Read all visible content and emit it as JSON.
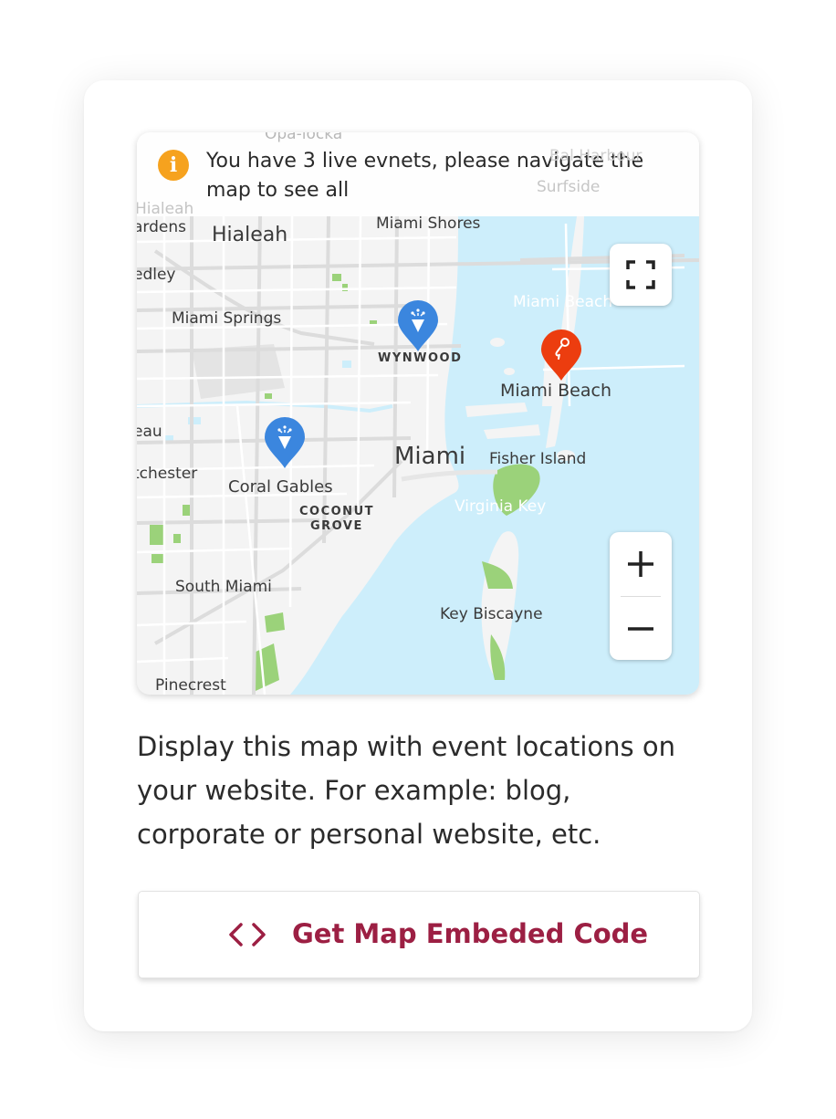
{
  "notice": {
    "icon": "info-icon",
    "icon_glyph": "i",
    "message": "You have 3 live evnets, please navigate the map to see all"
  },
  "map": {
    "labels": [
      {
        "id": "opa-locka",
        "text": "Opa-locka"
      },
      {
        "id": "surfside",
        "text": "Surfside"
      },
      {
        "id": "bal-harbour",
        "text": "Bal Harbour"
      },
      {
        "id": "hialeah-gardens-1",
        "text": "Hialeah"
      },
      {
        "id": "hialeah-gardens-2",
        "text": "ardens"
      },
      {
        "id": "hialeah",
        "text": "Hialeah"
      },
      {
        "id": "miami-shores",
        "text": "Miami Shores"
      },
      {
        "id": "medley",
        "text": "edley"
      },
      {
        "id": "miami-beach-top",
        "text": "Miami Beach"
      },
      {
        "id": "miami-springs",
        "text": "Miami Springs"
      },
      {
        "id": "wynwood",
        "text": "WYNWOOD"
      },
      {
        "id": "miami-beach",
        "text": "Miami Beach"
      },
      {
        "id": "sweetwater",
        "text": "eau"
      },
      {
        "id": "miami",
        "text": "Miami"
      },
      {
        "id": "fisher-island",
        "text": "Fisher Island"
      },
      {
        "id": "westchester",
        "text": "tchester"
      },
      {
        "id": "coral-gables",
        "text": "Coral Gables"
      },
      {
        "id": "coconut-grove-1",
        "text": "COCONUT"
      },
      {
        "id": "coconut-grove-2",
        "text": "GROVE"
      },
      {
        "id": "virginia-key",
        "text": "Virginia Key"
      },
      {
        "id": "south-miami",
        "text": "South Miami"
      },
      {
        "id": "key-biscayne",
        "text": "Key Biscayne"
      },
      {
        "id": "pinecrest",
        "text": "Pinecrest"
      }
    ],
    "markers": [
      {
        "id": "wynwood-event",
        "icon": "party-popper-icon",
        "color": "#3b86de"
      },
      {
        "id": "coral-gables-event",
        "icon": "party-popper-icon",
        "color": "#3b86de"
      },
      {
        "id": "miami-beach-event",
        "icon": "microphone-icon",
        "color": "#ec3d0f"
      }
    ],
    "controls": {
      "fullscreen_icon": "fullscreen-icon",
      "zoom_in_icon": "plus-icon",
      "zoom_out_icon": "minus-icon"
    },
    "colors": {
      "water": "#cdeefb",
      "land": "#f4f4f4",
      "road": "#ffffff",
      "park": "#9bd27a"
    }
  },
  "description": "Display this map with event locations on your website. For example: blog, corporate or personal website, etc.",
  "embed_button": {
    "icon": "code-icon",
    "label": "Get Map Embeded Code",
    "color": "#9c1f43"
  }
}
